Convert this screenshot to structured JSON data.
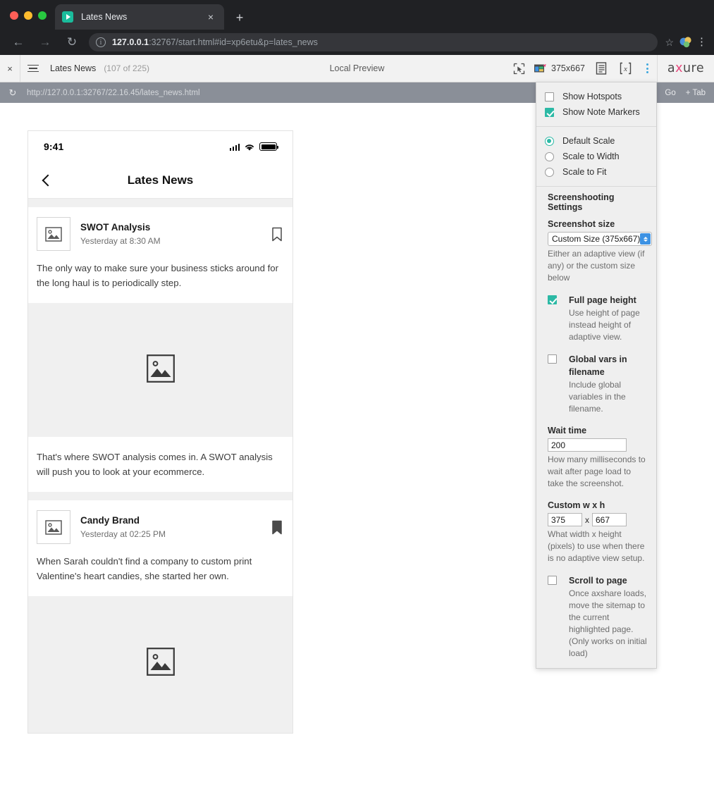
{
  "browser": {
    "tab": {
      "title": "Lates News",
      "favicon": "play-icon",
      "close_label": "×"
    },
    "newtab_label": "+",
    "nav": {
      "back": "←",
      "forward": "→",
      "reload": "↻"
    },
    "url": {
      "host": "127.0.0.1",
      "rest": ":32767/start.html#id=xp6etu&p=lates_news"
    },
    "star_label": "☆",
    "menu_label": "⋮"
  },
  "axure_toolbar": {
    "close_label": "×",
    "page_name": "Lates News",
    "page_count": "(107 of 225)",
    "center_label": "Local Preview",
    "viewport_size": "375x667",
    "logo_a": "a",
    "logo_x": "x",
    "logo_ure": "ure",
    "icons": [
      "hotspot-cursor-icon",
      "adaptive-view-icon",
      "notes-icon",
      "variables-icon",
      "overflow-kebab-icon"
    ]
  },
  "gray_strip": {
    "reload_label": "↻",
    "url": "http://127.0.0.1:32767/22.16.45/lates_news.html",
    "go_label": "Go",
    "tab_label": "Tab",
    "tab_plus": "+"
  },
  "phone": {
    "status": {
      "time": "9:41",
      "signal": "cellular-signal-icon",
      "wifi": "wifi-icon",
      "battery": "battery-icon"
    },
    "nav": {
      "back": "back-chevron-icon",
      "title": "Lates News"
    },
    "cards": [
      {
        "thumb": "image-placeholder-icon",
        "title": "SWOT Analysis",
        "date": "Yesterday at 8:30 AM",
        "bookmark": "bookmark-outline-icon",
        "body": "The only way to make sure your business sticks around for the long haul is to periodically step."
      },
      {
        "body_only": "That's where SWOT analysis comes in. A SWOT analysis will push you to look at your ecommerce."
      },
      {
        "thumb": "image-placeholder-icon",
        "title": "Candy Brand",
        "date": "Yesterday at 02:25 PM",
        "bookmark": "bookmark-filled-icon",
        "body": "When Sarah couldn't find a company to custom print Valentine's heart candies, she started her own."
      }
    ],
    "media_icon": "image-placeholder-icon"
  },
  "dropdown": {
    "toggles": [
      {
        "label": "Show Hotspots",
        "checked": false
      },
      {
        "label": "Show Note Markers",
        "checked": true
      }
    ],
    "scale_options": [
      {
        "label": "Default Scale",
        "selected": true
      },
      {
        "label": "Scale to Width",
        "selected": false
      },
      {
        "label": "Scale to Fit",
        "selected": false
      }
    ],
    "settings_heading": "Screenshooting Settings",
    "screenshot_size": {
      "label": "Screenshot size",
      "value": "Custom Size (375x667)",
      "help": "Either an adaptive view (if any) or the custom size below"
    },
    "full_page_height": {
      "label": "Full page height",
      "checked": true,
      "desc": "Use height of page instead height of adaptive view."
    },
    "global_vars": {
      "label": "Global vars in filename",
      "checked": false,
      "desc": "Include global variables in the filename."
    },
    "wait_time": {
      "label": "Wait time",
      "value": "200",
      "desc": "How many milliseconds to wait after page load to take the screenshot."
    },
    "custom_wh": {
      "label": "Custom w x h",
      "width": "375",
      "x": "x",
      "height": "667",
      "desc": "What width x height (pixels) to use when there is no adaptive view setup."
    },
    "scroll_to_page": {
      "label": "Scroll to page",
      "checked": false,
      "desc": "Once axshare loads, move the sitemap to the current highlighted page. (Only works on initial load)"
    }
  },
  "colors": {
    "accent_teal": "#2cb9a5",
    "chrome_dark": "#202124",
    "gray_strip": "#8a8f98",
    "spinner_blue": "#3d92e3"
  }
}
